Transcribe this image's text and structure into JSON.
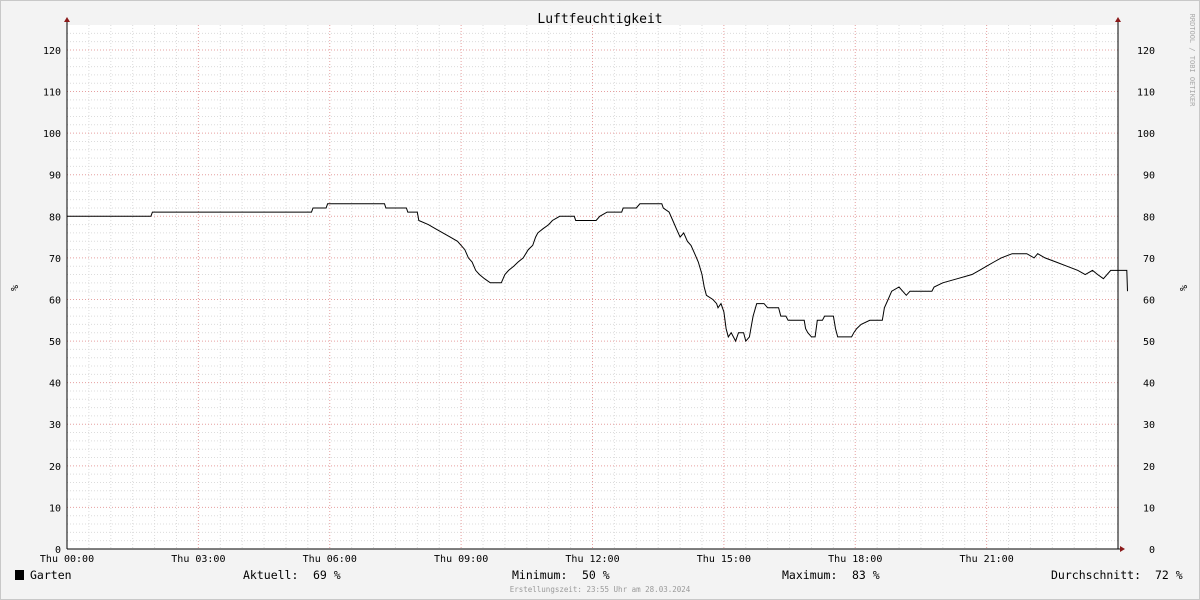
{
  "chart_data": {
    "type": "line",
    "title": "Luftfeuchtigkeit",
    "ylabel": "%",
    "ylim": [
      0,
      126
    ],
    "y_ticks": [
      0,
      10,
      20,
      30,
      40,
      50,
      60,
      70,
      80,
      90,
      100,
      110,
      120
    ],
    "xlim": [
      "00:00",
      "24:00"
    ],
    "x_ticks": [
      {
        "time": "00:00",
        "label": "Thu 00:00"
      },
      {
        "time": "03:00",
        "label": "Thu 03:00"
      },
      {
        "time": "06:00",
        "label": "Thu 06:00"
      },
      {
        "time": "09:00",
        "label": "Thu 09:00"
      },
      {
        "time": "12:00",
        "label": "Thu 12:00"
      },
      {
        "time": "15:00",
        "label": "Thu 15:00"
      },
      {
        "time": "18:00",
        "label": "Thu 18:00"
      },
      {
        "time": "21:00",
        "label": "Thu 21:00"
      }
    ],
    "grid": true,
    "series": [
      {
        "name": "Garten",
        "color": "#000000",
        "points": [
          [
            "00:00",
            80
          ],
          [
            "01:55",
            80
          ],
          [
            "01:57",
            81
          ],
          [
            "05:35",
            81
          ],
          [
            "05:37",
            82
          ],
          [
            "05:55",
            82
          ],
          [
            "05:57",
            83
          ],
          [
            "07:15",
            83
          ],
          [
            "07:17",
            82
          ],
          [
            "07:45",
            82
          ],
          [
            "07:47",
            81
          ],
          [
            "08:00",
            81
          ],
          [
            "08:02",
            79
          ],
          [
            "08:15",
            78
          ],
          [
            "08:25",
            77
          ],
          [
            "08:35",
            76
          ],
          [
            "08:45",
            75
          ],
          [
            "08:55",
            74
          ],
          [
            "09:05",
            72
          ],
          [
            "09:10",
            70
          ],
          [
            "09:15",
            69
          ],
          [
            "09:20",
            67
          ],
          [
            "09:25",
            66
          ],
          [
            "09:32",
            65
          ],
          [
            "09:40",
            64
          ],
          [
            "09:55",
            64
          ],
          [
            "10:00",
            66
          ],
          [
            "10:05",
            67
          ],
          [
            "10:12",
            68
          ],
          [
            "10:18",
            69
          ],
          [
            "10:25",
            70
          ],
          [
            "10:32",
            72
          ],
          [
            "10:38",
            73
          ],
          [
            "10:42",
            75
          ],
          [
            "10:45",
            76
          ],
          [
            "10:52",
            77
          ],
          [
            "11:00",
            78
          ],
          [
            "11:05",
            79
          ],
          [
            "11:15",
            80
          ],
          [
            "11:35",
            80
          ],
          [
            "11:37",
            79
          ],
          [
            "12:05",
            79
          ],
          [
            "12:10",
            80
          ],
          [
            "12:20",
            81
          ],
          [
            "12:40",
            81
          ],
          [
            "12:42",
            82
          ],
          [
            "13:00",
            82
          ],
          [
            "13:05",
            83
          ],
          [
            "13:35",
            83
          ],
          [
            "13:37",
            82
          ],
          [
            "13:45",
            81
          ],
          [
            "13:50",
            79
          ],
          [
            "13:55",
            77
          ],
          [
            "14:00",
            75
          ],
          [
            "14:05",
            76
          ],
          [
            "14:10",
            74
          ],
          [
            "14:15",
            73
          ],
          [
            "14:20",
            71
          ],
          [
            "14:25",
            69
          ],
          [
            "14:30",
            66
          ],
          [
            "14:33",
            63
          ],
          [
            "14:36",
            61
          ],
          [
            "14:45",
            60
          ],
          [
            "14:50",
            59
          ],
          [
            "14:52",
            58
          ],
          [
            "14:56",
            59
          ],
          [
            "15:00",
            57
          ],
          [
            "15:03",
            53
          ],
          [
            "15:06",
            51
          ],
          [
            "15:10",
            52
          ],
          [
            "15:13",
            51
          ],
          [
            "15:16",
            50
          ],
          [
            "15:20",
            52
          ],
          [
            "15:27",
            52
          ],
          [
            "15:30",
            50
          ],
          [
            "15:35",
            51
          ],
          [
            "15:38",
            54
          ],
          [
            "15:40",
            56
          ],
          [
            "15:45",
            59
          ],
          [
            "15:55",
            59
          ],
          [
            "16:00",
            58
          ],
          [
            "16:15",
            58
          ],
          [
            "16:18",
            56
          ],
          [
            "16:25",
            56
          ],
          [
            "16:28",
            55
          ],
          [
            "16:50",
            55
          ],
          [
            "16:52",
            53
          ],
          [
            "16:55",
            52
          ],
          [
            "17:00",
            51
          ],
          [
            "17:05",
            51
          ],
          [
            "17:08",
            55
          ],
          [
            "17:15",
            55
          ],
          [
            "17:18",
            56
          ],
          [
            "17:30",
            56
          ],
          [
            "17:33",
            53
          ],
          [
            "17:36",
            51
          ],
          [
            "17:55",
            51
          ],
          [
            "17:58",
            52
          ],
          [
            "18:02",
            53
          ],
          [
            "18:08",
            54
          ],
          [
            "18:20",
            55
          ],
          [
            "18:37",
            55
          ],
          [
            "18:40",
            58
          ],
          [
            "18:45",
            60
          ],
          [
            "18:50",
            62
          ],
          [
            "19:00",
            63
          ],
          [
            "19:10",
            61
          ],
          [
            "19:15",
            62
          ],
          [
            "19:45",
            62
          ],
          [
            "19:48",
            63
          ],
          [
            "20:00",
            64
          ],
          [
            "20:20",
            65
          ],
          [
            "20:40",
            66
          ],
          [
            "20:50",
            67
          ],
          [
            "21:00",
            68
          ],
          [
            "21:10",
            69
          ],
          [
            "21:20",
            70
          ],
          [
            "21:35",
            71
          ],
          [
            "21:55",
            71
          ],
          [
            "22:05",
            70
          ],
          [
            "22:10",
            71
          ],
          [
            "22:20",
            70
          ],
          [
            "22:35",
            69
          ],
          [
            "22:50",
            68
          ],
          [
            "23:05",
            67
          ],
          [
            "23:15",
            66
          ],
          [
            "23:25",
            67
          ],
          [
            "23:32",
            66
          ],
          [
            "23:40",
            65
          ],
          [
            "23:50",
            67
          ],
          [
            "24:00",
            67
          ],
          [
            "24:12",
            67
          ],
          [
            "24:13",
            62
          ]
        ]
      }
    ],
    "legend": {
      "series_name": "Garten",
      "aktuell_label": "Aktuell:",
      "aktuell_value": "69 %",
      "minimum_label": "Minimum:",
      "minimum_value": "50 %",
      "maximum_label": "Maximum:",
      "maximum_value": "83 %",
      "durchschnitt_label": "Durchschnitt:",
      "durchschnitt_value": "72 %"
    },
    "watermark": "RRDTOOL / TOBI OETIKER",
    "created": "Erstellungszeit: 23:55 Uhr am 28.03.2024"
  }
}
